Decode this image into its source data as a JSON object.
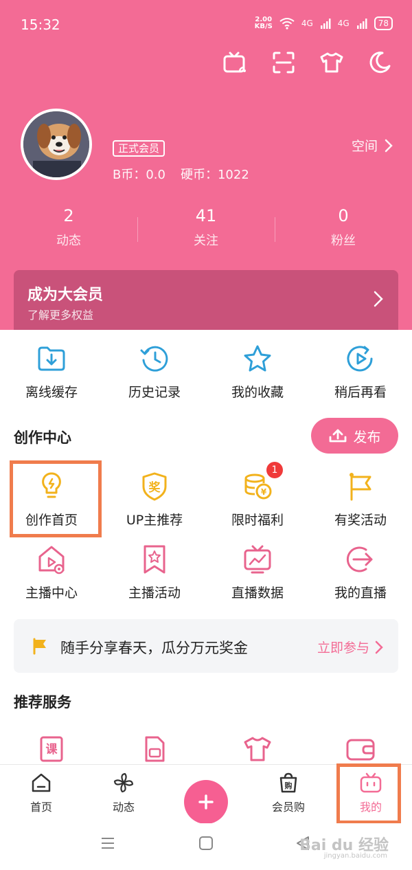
{
  "status_bar": {
    "time": "15:32",
    "net_speed_value": "2.00",
    "net_speed_unit": "KB/S",
    "signal_1": "4G",
    "signal_2": "4G",
    "battery": "78"
  },
  "profile": {
    "member_badge": "正式会员",
    "b_coin": "B币：0.0",
    "hard_coin": "硬币：1022",
    "space_link": "空间"
  },
  "stats": [
    {
      "value": "2",
      "label": "动态"
    },
    {
      "value": "41",
      "label": "关注"
    },
    {
      "value": "0",
      "label": "粉丝"
    }
  ],
  "vip_banner": {
    "title": "成为大会员",
    "subtitle": "了解更多权益"
  },
  "quick_actions": [
    {
      "label": "离线缓存",
      "icon": "download-folder-icon"
    },
    {
      "label": "历史记录",
      "icon": "history-icon"
    },
    {
      "label": "我的收藏",
      "icon": "star-icon"
    },
    {
      "label": "稍后再看",
      "icon": "watch-later-icon"
    }
  ],
  "creator_center": {
    "title": "创作中心",
    "publish_label": "发布",
    "row1": [
      {
        "label": "创作首页",
        "icon": "lightbulb-icon"
      },
      {
        "label": "UP主推荐",
        "icon": "award-badge-icon"
      },
      {
        "label": "限时福利",
        "icon": "coins-icon",
        "badge": "1"
      },
      {
        "label": "有奖活动",
        "icon": "flag-icon"
      }
    ],
    "row2": [
      {
        "label": "主播中心",
        "icon": "live-home-icon"
      },
      {
        "label": "主播活动",
        "icon": "bookmark-star-icon"
      },
      {
        "label": "直播数据",
        "icon": "tv-chart-icon"
      },
      {
        "label": "我的直播",
        "icon": "enter-arrow-icon"
      }
    ]
  },
  "promo": {
    "text": "随手分享春天，瓜分万元奖金",
    "link": "立即参与"
  },
  "services": {
    "title": "推荐服务"
  },
  "tab_bar": {
    "items": [
      {
        "label": "首页",
        "icon": "home-icon"
      },
      {
        "label": "动态",
        "icon": "pinwheel-icon"
      },
      {
        "label": "",
        "icon": "plus-icon"
      },
      {
        "label": "会员购",
        "icon": "shopping-bag-icon"
      },
      {
        "label": "我的",
        "icon": "tv-face-icon"
      }
    ]
  },
  "watermark": {
    "brand": "Bai du 经验",
    "url": "jingyan.baidu.com"
  },
  "colors": {
    "brand_pink": "#f36b95",
    "highlight_orange": "#f07c4d",
    "icon_blue": "#2e9fd8",
    "icon_yellow": "#f2b21c"
  }
}
